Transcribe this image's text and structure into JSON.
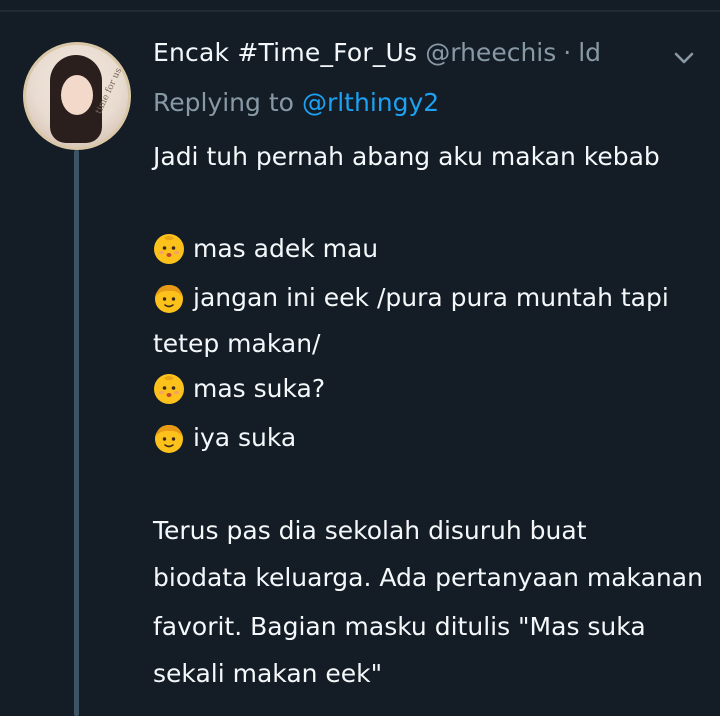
{
  "tweet": {
    "display_name": "Encak #Time_For_Us",
    "handle": "@rheechis",
    "separator": "·",
    "time": "ld",
    "replying_prefix": "Replying to",
    "replying_to": "@rlthingy2",
    "lines": [
      {
        "text": "Jadi tuh pernah abang aku makan kebab"
      },
      {
        "emoji": "baby-face-icon",
        "text": "mas adek mau"
      },
      {
        "emoji": "boy-face-icon",
        "text": "jangan ini eek /pura pura muntah tapi"
      },
      {
        "text": "tetep makan/"
      },
      {
        "emoji": "baby-face-icon",
        "text": "mas suka?"
      },
      {
        "emoji": "boy-face-icon",
        "text": "iya suka"
      },
      {
        "text": "Terus pas dia sekolah disuruh buat"
      },
      {
        "text": "biodata keluarga. Ada pertanyaan makanan"
      },
      {
        "text": "favorit. Bagian masku ditulis \"Mas suka"
      },
      {
        "text": "sekali makan eek\""
      }
    ]
  },
  "colors": {
    "background": "#141d26",
    "text": "#f5f8fa",
    "muted": "#8899a6",
    "link": "#1da1f2",
    "thread_line": "#3d5466",
    "emoji_yellow": "#fcc21b"
  },
  "avatar_text": "time for us"
}
